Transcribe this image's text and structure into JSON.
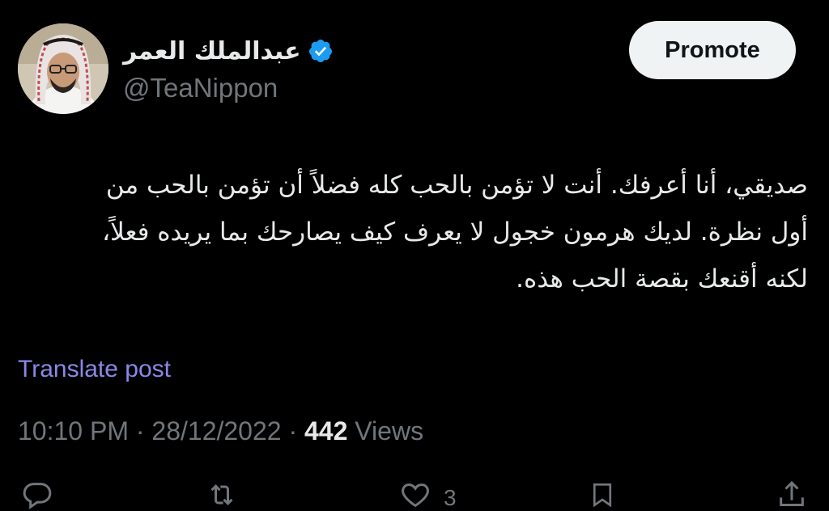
{
  "author": {
    "display_name": "عبدالملك العمر",
    "handle": "@TeaNippon",
    "verified_icon": "verified-badge-icon",
    "avatar_icon": "user-avatar"
  },
  "promote_label": "Promote",
  "tweet": {
    "text": "صديقي، أنا أعرفك. أنت لا تؤمن بالحب كله فضلاً أن تؤمن بالحب من أول نظرة. لديك هرمون خجول لا يعرف كيف يصارحك بما يريده فعلاً، لكنه أقنعك بقصة الحب هذه."
  },
  "translate_label": "Translate post",
  "meta": {
    "time": "10:10 PM",
    "separator": " · ",
    "date": "28/12/2022",
    "views_count": "442",
    "views_label": " Views"
  },
  "actions": {
    "reply_icon": "reply-icon",
    "repost_icon": "repost-icon",
    "like_icon": "heart-icon",
    "like_count": "3",
    "bookmark_icon": "bookmark-icon",
    "share_icon": "share-icon"
  },
  "colors": {
    "background": "#000000",
    "text": "#e7e9ea",
    "secondary": "#71767b",
    "translate": "#8b88e6",
    "verified": "#1d9bf0",
    "promote_bg": "#eff3f4"
  }
}
